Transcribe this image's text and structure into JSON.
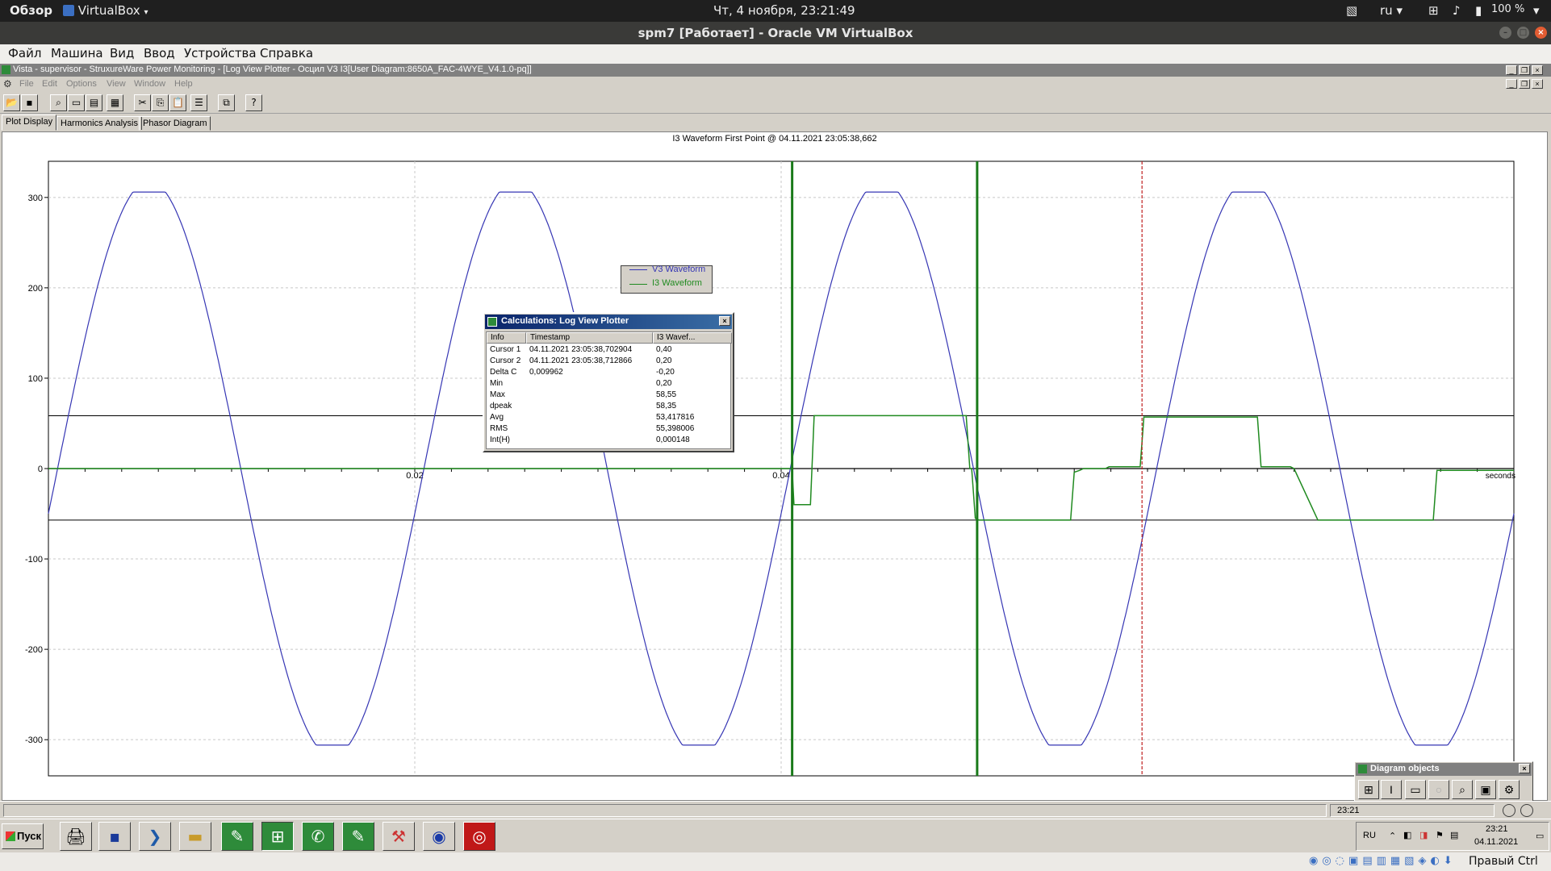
{
  "gnome": {
    "activities": "Обзор",
    "app_name": "VirtualBox",
    "clock": "Чт, 4 ноября, 23:21:49",
    "keyboard_layout": "ru",
    "battery": "100 %"
  },
  "vbox": {
    "window_title": "spm7 [Работает] - Oracle VM VirtualBox",
    "menu": [
      "Файл",
      "Машина",
      "Вид",
      "Ввод",
      "Устройства",
      "Справка"
    ],
    "host_key": "Правый Ctrl"
  },
  "app": {
    "mdi_title": "Vista - supervisor - StruxureWare Power Monitoring - [Log View Plotter - Осцил V3 I3[User Diagram:8650A_FAC-4WYE_V4.1.0-pq]]",
    "menu": [
      "File",
      "Edit",
      "Options",
      "View",
      "Window",
      "Help"
    ],
    "tabs": [
      "Plot Display",
      "Harmonics Analysis",
      "Phasor Diagram"
    ],
    "active_tab": "Plot Display"
  },
  "plot": {
    "title": "I3 Waveform First Point @ 04.11.2021 23:05:38,662",
    "x_unit_label": "seconds",
    "legend": [
      {
        "name": "V3 Waveform",
        "color": "#3636b4"
      },
      {
        "name": "I3 Waveform",
        "color": "#1f8a1f"
      }
    ],
    "cursor_color": "#1a7a1a",
    "marker_color": "#c02020"
  },
  "chart_data": {
    "type": "line",
    "title": "I3 Waveform First Point @ 04.11.2021 23:05:38,662",
    "xlabel": "seconds",
    "ylabel": "",
    "xlim": [
      0,
      0.08
    ],
    "ylim": [
      -340,
      340
    ],
    "x_ticks": [
      0.02,
      0.04
    ],
    "x_tick_labels": [
      "0.02",
      "0.04"
    ],
    "y_ticks": [
      300,
      200,
      100,
      0,
      -100,
      -200,
      -300
    ],
    "y_tick_labels": [
      "300",
      "200",
      "100",
      "0",
      "-100",
      "-200",
      "-300"
    ],
    "series": [
      {
        "name": "V3 Waveform",
        "color": "#3636b4",
        "amplitude": 306,
        "period": 0.02,
        "phase_zero_crossing": 0.0005
      },
      {
        "name": "I3 Waveform",
        "color": "#1f8a1f",
        "x": [
          0.0,
          0.0406,
          0.0407,
          0.0416,
          0.0418,
          0.0501,
          0.0503,
          0.0504,
          0.0506,
          0.0508,
          0.0558,
          0.056,
          0.0563,
          0.0565,
          0.0577,
          0.0579,
          0.0596,
          0.0598,
          0.066,
          0.0662,
          0.0678,
          0.068,
          0.0693,
          0.0695,
          0.0756,
          0.0758,
          0.08
        ],
        "y": [
          0,
          0,
          -40,
          -40,
          58.5,
          58.5,
          0,
          0,
          -55,
          -57,
          -57,
          -4,
          -2,
          0,
          0,
          2,
          2,
          57,
          57,
          2,
          2,
          0,
          -57,
          -57,
          -57,
          -2,
          -2
        ]
      }
    ],
    "cursors_x": [
      0.0406,
      0.0507
    ],
    "marker_x": 0.0597,
    "horizontal_lines_y": [
      58.5,
      -57
    ],
    "grid": true
  },
  "calc": {
    "title": "Calculations: Log View Plotter",
    "columns": [
      "Info",
      "Timestamp",
      "I3 Wavef..."
    ],
    "rows": [
      [
        "Cursor 1",
        "04.11.2021 23:05:38,702904",
        "0,40"
      ],
      [
        "Cursor 2",
        "04.11.2021 23:05:38,712866",
        "0,20"
      ],
      [
        "Delta C",
        "0,009962",
        "-0,20"
      ],
      [
        "Min",
        "",
        "0,20"
      ],
      [
        "Max",
        "",
        "58,55"
      ],
      [
        "dpeak",
        "",
        "58,35"
      ],
      [
        "Avg",
        "",
        "53,417816"
      ],
      [
        "RMS",
        "",
        "55,398006"
      ],
      [
        "Int(H)",
        "",
        "0,000148"
      ]
    ]
  },
  "diagram_objects": {
    "title": "Diagram objects"
  },
  "status": {
    "time": "23:21"
  },
  "taskbar": {
    "start_label": "Пуск",
    "lang": "RU",
    "time": "23:21",
    "date": "04.11.2021"
  }
}
